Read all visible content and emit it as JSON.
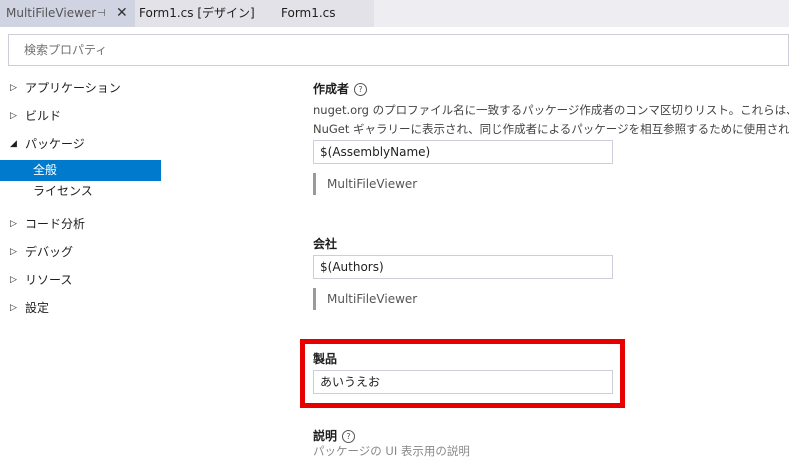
{
  "tabs": [
    {
      "label": "MultiFileViewer",
      "pin_icon": "pin-icon",
      "close_icon": "close-icon"
    },
    {
      "label": "Form1.cs [デザイン]"
    },
    {
      "label": "Form1.cs"
    }
  ],
  "search": {
    "placeholder": "検索プロパティ",
    "value": ""
  },
  "nav": {
    "items": [
      {
        "label": "アプリケーション",
        "expanded": false
      },
      {
        "label": "ビルド",
        "expanded": false
      },
      {
        "label": "パッケージ",
        "expanded": true
      },
      {
        "label": "コード分析",
        "expanded": false
      },
      {
        "label": "デバッグ",
        "expanded": false
      },
      {
        "label": "リソース",
        "expanded": false
      },
      {
        "label": "設定",
        "expanded": false
      }
    ],
    "package_children": [
      {
        "label": "全般",
        "selected": true
      },
      {
        "label": "ライセンス",
        "selected": false
      }
    ]
  },
  "fields": {
    "authors": {
      "title": "作成者",
      "desc_line1": "nuget.org のプロファイル名に一致するパッケージ作成者のコンマ区切りリスト。これらは、nuget.org の",
      "desc_line2": "NuGet ギャラリーに表示され、同じ作成者によるパッケージを相互参照するために使用されます。",
      "value": "$(AssemblyName)",
      "evaluated": "MultiFileViewer"
    },
    "company": {
      "title": "会社",
      "value": "$(Authors)",
      "evaluated": "MultiFileViewer"
    },
    "product": {
      "title": "製品",
      "value": "あいうえお"
    },
    "description": {
      "title": "説明",
      "partial_text": "パッケージの UI 表示用の説明"
    }
  },
  "colors": {
    "accent": "#007acc",
    "highlight": "#e60000"
  }
}
